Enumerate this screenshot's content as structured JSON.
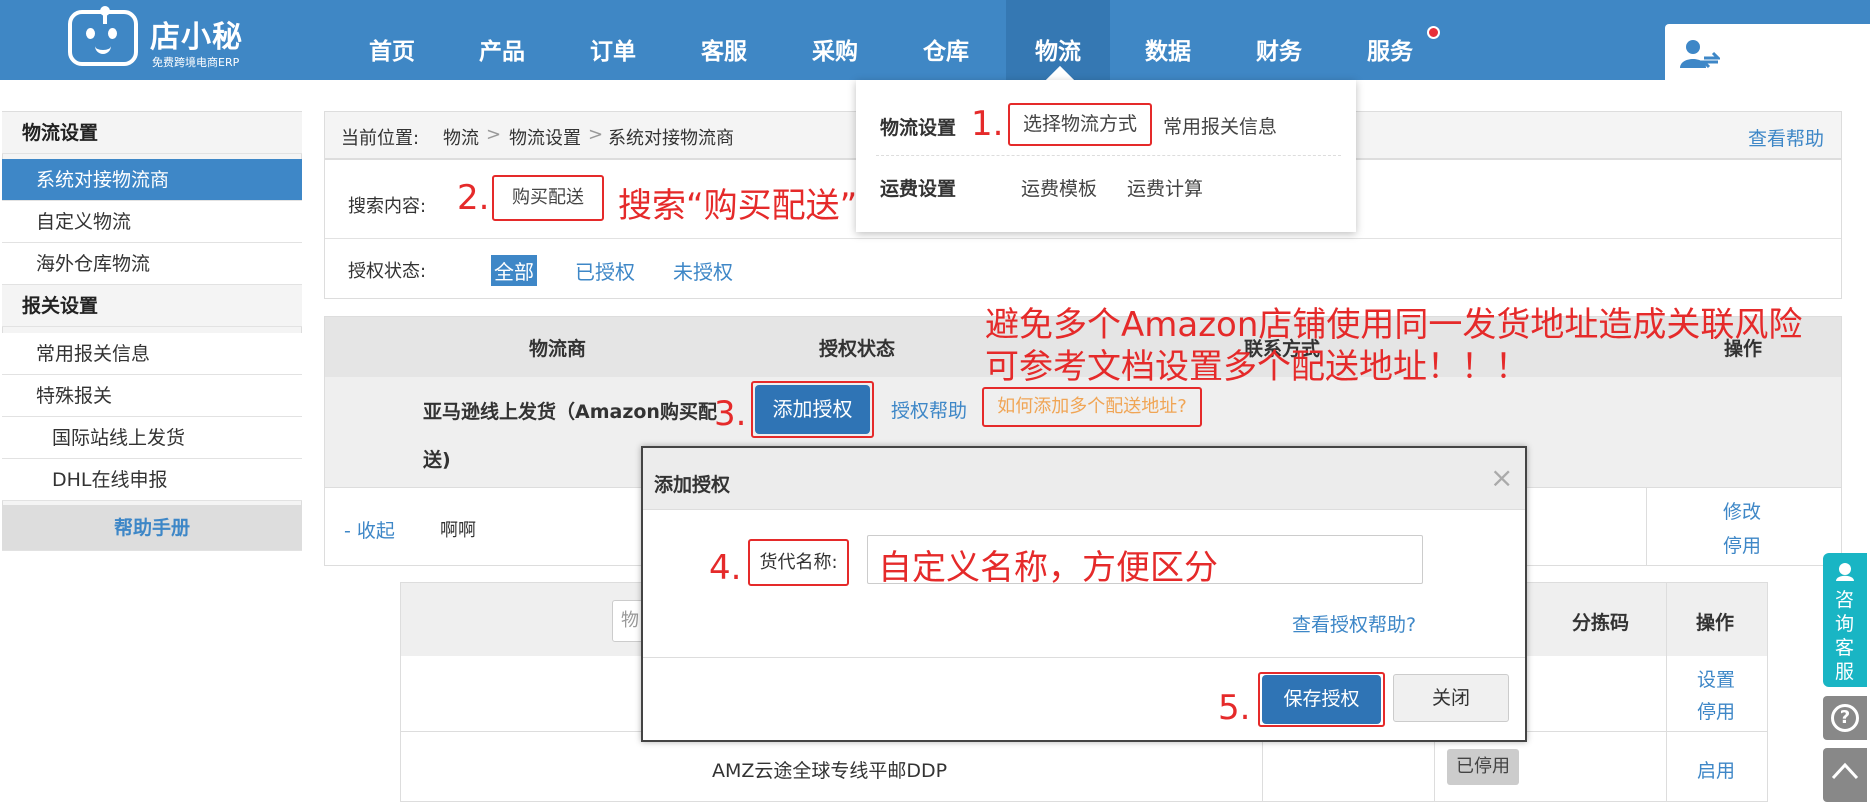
{
  "header": {
    "logo_title": "店小秘",
    "logo_subtitle": "免费跨境电商ERP",
    "nav": [
      "首页",
      "产品",
      "订单",
      "客服",
      "采购",
      "仓库",
      "物流",
      "数据",
      "财务",
      "服务"
    ],
    "active_nav": "物流",
    "colors": {
      "bar": "#3f87c5",
      "active": "#3578b3",
      "notify_dot": "#e8303a"
    },
    "user_icon": "user-icon"
  },
  "dropdown": {
    "logistics_settings_label": "物流设置",
    "choose_method": "选择物流方式",
    "customs_info": "常用报关信息",
    "freight_settings_label": "运费设置",
    "freight_template": "运费模板",
    "freight_calc": "运费计算"
  },
  "sidebar": {
    "section1": "物流设置",
    "items1": [
      "系统对接物流商",
      "自定义物流",
      "海外仓库物流"
    ],
    "section2": "报关设置",
    "items2": [
      "常用报关信息",
      "特殊报关"
    ],
    "items3": [
      "国际站线上发货",
      "DHL在线申报"
    ],
    "help": "帮助手册",
    "active_color": "#3e87c7"
  },
  "breadcrumb": {
    "prefix": "当前位置:",
    "path1": "物流",
    "path2": "物流设置",
    "path3": "系统对接物流商",
    "sep": ">",
    "help_link": "查看帮助"
  },
  "search": {
    "label": "搜索内容:",
    "value": "购买配送"
  },
  "auth_filter": {
    "label": "授权状态:",
    "options": [
      "全部",
      "已授权",
      "未授权"
    ],
    "selected": "全部"
  },
  "table": {
    "headers": [
      "物流商",
      "授权状态",
      "联系方式",
      "操作"
    ],
    "row1": {
      "name_line1": "亚马逊线上发货（Amazon购买配",
      "name_line2": "送)",
      "add_auth": "添加授权",
      "auth_help": "授权帮助",
      "multi_addr": "如何添加多个配送地址?"
    },
    "row2": {
      "collapse": "- 收起",
      "name": "啊啊",
      "edit": "修改",
      "disable": "停用"
    }
  },
  "inner_table": {
    "search_placeholder": "物",
    "headers": [
      "分拣码",
      "操作"
    ],
    "row1_actions": [
      "设置",
      "停用"
    ],
    "row2_name": "AMZ云途全球专线平邮DDP",
    "row2_status": "已停用",
    "row2_action": "启用"
  },
  "modal": {
    "title": "添加授权",
    "close_x": "×",
    "field_label": "货代名称:",
    "field_value": "自定义名称，方便区分",
    "help_link": "查看授权帮助?",
    "save": "保存授权",
    "close": "关闭"
  },
  "annotations": {
    "step1": "1.",
    "step2": "2.",
    "step3": "3.",
    "step4": "4.",
    "step5": "5.",
    "search_hint": "搜索“购买配送”",
    "warning_line1": "避免多个Amazon店铺使用同一发货地址造成关联风险",
    "warning_line2": "可参考文档设置多个配送地址！！！",
    "color": "#e52a2a"
  },
  "right_widgets": {
    "consult_label": "咨询客服",
    "help_icon": "question-icon",
    "top_icon": "back-to-top-icon"
  }
}
